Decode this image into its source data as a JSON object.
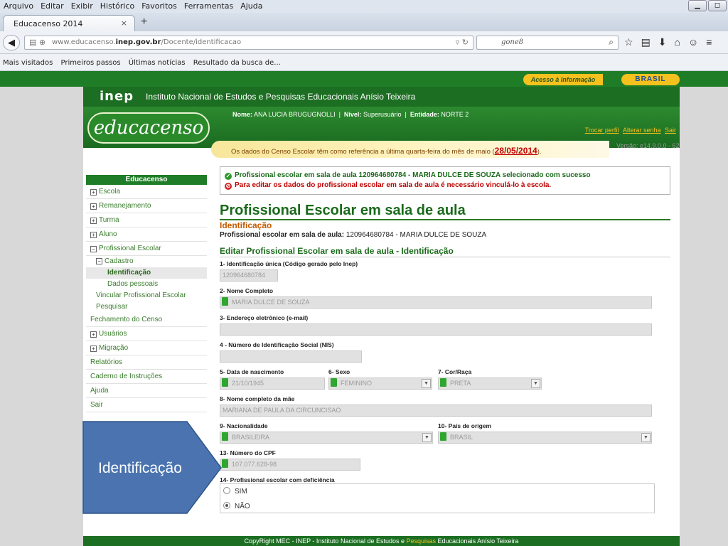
{
  "menubar": {
    "items": [
      "Arquivo",
      "Editar",
      "Exibir",
      "Histórico",
      "Favoritos",
      "Ferramentas",
      "Ajuda"
    ]
  },
  "tab": {
    "title": "Educacenso 2014",
    "close": "×",
    "new": "+"
  },
  "address": {
    "prefix": "www.educacenso.",
    "domain": "inep.gov.br",
    "path": "/Docente/identificacao"
  },
  "search": {
    "value": "gone8"
  },
  "bookmarks": [
    "Mais visitados",
    "Primeiros passos",
    "Últimas notícias",
    "Resultado da busca de..."
  ],
  "gov": {
    "acesso": "Acesso à Informação",
    "brasil": "BRASIL"
  },
  "inep": {
    "logo": "inep",
    "name": "Instituto Nacional de Estudos e Pesquisas Educacionais Anísio Teixeira"
  },
  "header": {
    "logo": "educacenso",
    "nome_label": "Nome:",
    "nome_value": "ANA LUCIA BRUGUGNOLLI",
    "nivel_label": "Nível:",
    "nivel_value": "Superusuário",
    "entidade_label": "Entidade:",
    "entidade_value": "NORTE 2",
    "links": [
      "Trocar perfil",
      "Alterar senha",
      "Sair"
    ],
    "notice": "Os dados do Censo Escolar têm como referência a última quarta-feira do mês de maio (",
    "notice_date": "28/05/2014",
    "notice_end": ").",
    "versao": "Versão: e14.9.0.0 - 62"
  },
  "sidebar": {
    "header": "Educacenso",
    "items": [
      {
        "label": "Escola",
        "pm": "+"
      },
      {
        "label": "Remanejamento",
        "pm": "+"
      },
      {
        "label": "Turma",
        "pm": "+"
      },
      {
        "label": "Aluno",
        "pm": "+"
      },
      {
        "label": "Profissional Escolar",
        "pm": "−"
      }
    ],
    "cadastro": "Cadastro",
    "identificacao": "Identificação",
    "dados_pessoais": "Dados pessoais",
    "vincular": "Vincular Profissional Escolar",
    "pesquisar": "Pesquisar",
    "after": [
      {
        "label": "Fechamento do Censo",
        "pm": ""
      },
      {
        "label": "Usuários",
        "pm": "+"
      },
      {
        "label": "Migração",
        "pm": "+"
      },
      {
        "label": "Relatórios",
        "pm": ""
      },
      {
        "label": "Caderno de Instruções",
        "pm": ""
      },
      {
        "label": "Ajuda",
        "pm": ""
      },
      {
        "label": "Sair",
        "pm": ""
      }
    ]
  },
  "messages": {
    "success": "Profissional escolar em sala de aula 120964680784 - MARIA DULCE DE SOUZA selecionado com sucesso",
    "error": "Para editar os dados do profissional escolar em sala de aula é necessário vinculá-lo à escola."
  },
  "main": {
    "title": "Profissional Escolar em sala de aula",
    "subtitle": "Identificação",
    "prof_label": "Profissional escolar em sala de aula:",
    "prof_value": "120964680784 - MARIA DULCE DE SOUZA",
    "edit_title": "Editar Profissional Escolar em sala de aula - Identificação"
  },
  "form": {
    "f1_label": "1- Identificação única (Código gerado pelo Inep)",
    "f1_value": "120964680784",
    "f2_label": "2- Nome Completo",
    "f2_value": "MARIA DULCE DE SOUZA",
    "f3_label": "3- Endereço eletrônico (e-mail)",
    "f3_value": "",
    "f4_label": "4 - Número de Identificação Social (NIS)",
    "f4_value": "",
    "f5_label": "5- Data de nascimento",
    "f5_value": "21/10/1945",
    "f6_label": "6- Sexo",
    "f6_value": "FEMININO",
    "f7_label": "7- Cor/Raça",
    "f7_value": "PRETA",
    "f8_label": "8- Nome completo da mãe",
    "f8_value": "MARIANA DE PAULA DA CIRCUNCISAO",
    "f9_label": "9- Nacionalidade",
    "f9_value": "BRASILEIRA",
    "f10_label": "10- País de origem",
    "f10_value": "BRASIL",
    "f13_label": "13- Número do CPF",
    "f13_value": "107.077.628-98",
    "f14_label": "14- Profissional escolar com deficiência",
    "f14_options": [
      "SIM",
      "NÃO"
    ],
    "f14_selected": "NÃO"
  },
  "footer": {
    "pre": "CopyRight MEC - INEP - Instituto Nacional de Estudos e ",
    "hl": "Pesquisas",
    "post": " Educacionais Anísio Teixeira"
  },
  "callout": {
    "text": "Identificação",
    "color": "#4a73b0"
  },
  "colors": {
    "green_dark": "#1c6e22",
    "accent_yellow": "#f4c11e",
    "title_green": "#1a6a1a",
    "error_red": "#c00000"
  }
}
